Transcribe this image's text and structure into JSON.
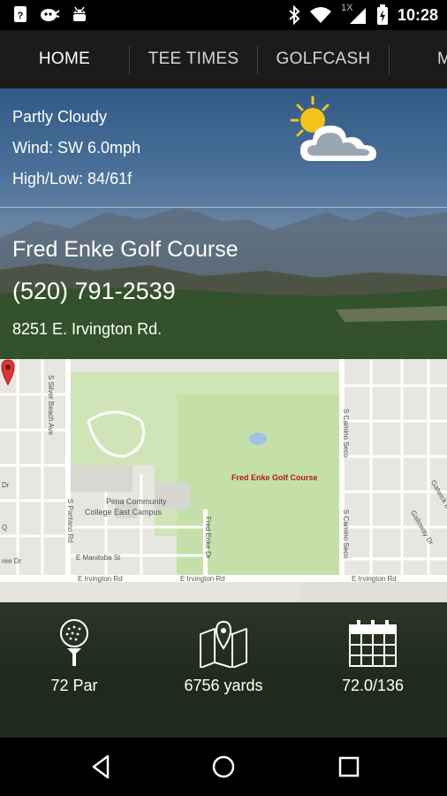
{
  "status_bar": {
    "time": "10:28",
    "icons": [
      "sim-icon",
      "cat-icon",
      "android-icon",
      "bluetooth-icon",
      "wifi-icon",
      "signal-icon",
      "battery-icon"
    ],
    "network_label": "1X"
  },
  "tabs": [
    {
      "label": "HOME",
      "active": true
    },
    {
      "label": "TEE TIMES",
      "active": false
    },
    {
      "label": "GOLFCASH",
      "active": false
    },
    {
      "label": "M",
      "active": false
    }
  ],
  "weather": {
    "condition": "Partly Cloudy",
    "wind": "Wind: SW 6.0mph",
    "high_low": "High/Low: 84/61f",
    "icon": "partly-cloudy-icon"
  },
  "course": {
    "name": "Fred Enke Golf Course",
    "phone": "(520) 791-2539",
    "address": "8251 E. Irvington Rd."
  },
  "map": {
    "pin_label": "Fred Enke Golf Course",
    "streets": [
      "S Silver Beach Ave",
      "S Pantano Rd",
      "E Manitoba St",
      "E Irvington Rd",
      "E Irvington Rd",
      "E Irvington Rd",
      "Fred Enke Dr",
      "S Camino Seco",
      "S Camino Seco",
      "Gatwick Dr",
      "Galloway Dr"
    ],
    "poi": [
      "Pima Community",
      "College East Campus"
    ],
    "edge_labels": [
      "Dr",
      "Q",
      "ree Dr"
    ]
  },
  "stats": [
    {
      "icon": "golf-ball-icon",
      "label": "72 Par"
    },
    {
      "icon": "map-location-icon",
      "label": "6756 yards"
    },
    {
      "icon": "calendar-icon",
      "label": "72.0/136"
    }
  ],
  "nav": [
    "back-icon",
    "home-icon",
    "recents-icon"
  ],
  "colors": {
    "accent": "#7dd3d3",
    "pin": "#d93a32",
    "tab_bar": "#1b1b1b"
  }
}
